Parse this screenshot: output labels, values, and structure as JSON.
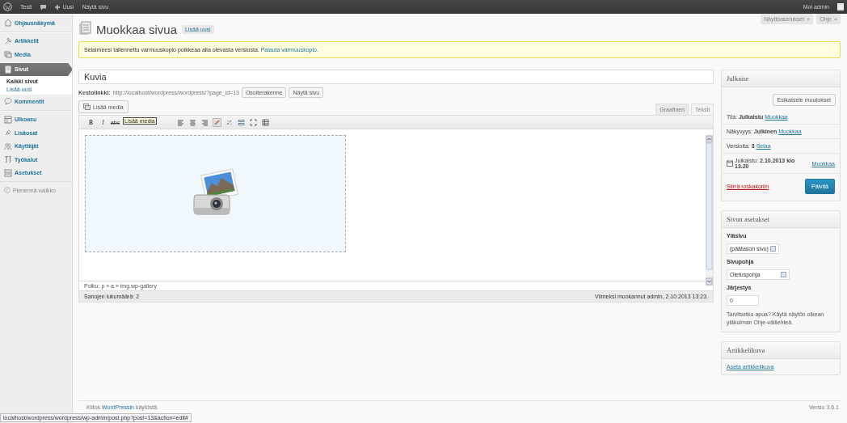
{
  "admin_bar": {
    "site": "Testi",
    "new": "Uusi",
    "view": "Näytä sivu",
    "greeting": "Moi admin"
  },
  "sidebar": {
    "groups": [
      [
        {
          "label": "Ohjausnäkymä",
          "selected": false
        }
      ],
      [
        {
          "label": "Artikkelit",
          "selected": false
        },
        {
          "label": "Media",
          "selected": false
        },
        {
          "label": "Sivut",
          "selected": true,
          "children": [
            {
              "label": "Kaikki sivut",
              "selected": true
            },
            {
              "label": "Lisää uusi",
              "selected": false
            }
          ]
        },
        {
          "label": "Kommentit",
          "selected": false
        }
      ],
      [
        {
          "label": "Ulkoasu",
          "selected": false
        },
        {
          "label": "Lisäosat",
          "selected": false
        },
        {
          "label": "Käyttäjät",
          "selected": false
        },
        {
          "label": "Työkalut",
          "selected": false
        },
        {
          "label": "Asetukset",
          "selected": false
        }
      ]
    ],
    "collapse": "Pienennä valikko"
  },
  "screen_tabs": [
    "Näyttöasetukset",
    "Ohje"
  ],
  "page_title": "Muokkaa sivua",
  "add_new": "Lisää uusi",
  "notice": {
    "text": "Selaimeesi tallennettu varmuuskopio poikkeaa alla olevasta versiosta.",
    "link": "Palauta varmuuskopio."
  },
  "post_title": "Kuvia",
  "permalink": {
    "label": "Kestolinkki:",
    "url": "http://localhost/wordpress/wordpress/?page_id=13",
    "buttons": [
      "Osoiterakenne",
      "Näytä sivu"
    ]
  },
  "add_media": "Lisää media",
  "editor_tabs": [
    {
      "label": "Graafinen",
      "selected": true
    },
    {
      "label": "Teksti",
      "selected": false
    }
  ],
  "toolbar": {
    "items": [
      {
        "kind": "bold",
        "label": "B",
        "pressed": false
      },
      {
        "kind": "italic",
        "label": "I",
        "pressed": false
      },
      {
        "kind": "strikethrough",
        "label": "abc",
        "pressed": false
      },
      {
        "kind": "tooltip",
        "label": "Lisää media"
      },
      {
        "kind": "align-left",
        "pressed": false
      },
      {
        "kind": "align-center",
        "pressed": false
      },
      {
        "kind": "align-right",
        "pressed": false
      },
      {
        "kind": "link",
        "pressed": true
      },
      {
        "kind": "unlink",
        "pressed": false
      },
      {
        "kind": "more",
        "pressed": false
      },
      {
        "kind": "fullscreen",
        "pressed": false
      },
      {
        "kind": "kitchen-sink",
        "pressed": false
      }
    ]
  },
  "path": "Polku: p » a » img.wp-gallery",
  "word_count": "Sanojen lukumäärä: 2",
  "last_edited": "Viimeksi muokannut admin, 2.10.2013 13:23.",
  "publish": {
    "title": "Julkaise",
    "preview": "Esikatsele muutokset",
    "rows": [
      {
        "kind": "plain",
        "text": "Tila: **Julkaistu**",
        "link": "Muokkaa"
      },
      {
        "kind": "plain",
        "text": "Näkyvyys: **Julkinen**",
        "link": "Muokkaa"
      },
      {
        "kind": "plain",
        "text": "Versioita: **3**",
        "link": "Selaa"
      },
      {
        "kind": "date",
        "text": "Julkaistu: **2.10.2013 klo 13.20**",
        "link": "Muokkaa"
      }
    ],
    "trash": "Siirrä roskakoriin",
    "update": "Päivitä"
  },
  "page_attributes": {
    "title": "Sivun asetukset",
    "parent_label": "Yläsivu",
    "parent_value": "(päätason sivu)",
    "template_label": "Sivupohja",
    "template_value": "Oletuspohja",
    "order_label": "Järjestys",
    "order_value": "0",
    "help": "Tarvitsetko apua? Käytä näytön oikean yläkulman Ohje-välilehteä."
  },
  "featured_image": {
    "title": "Artikkelikuva",
    "link": "Aseta artikkelikuva"
  },
  "footer": {
    "thanks_before": "Kiitos",
    "thanks_link": "WordPressin",
    "thanks_after": "käytöstä.",
    "version": "Versio 3.6.1"
  },
  "status_url": "localhost/wordpress/wordpress/wp-admin/post.php?post=13&action=edit#"
}
